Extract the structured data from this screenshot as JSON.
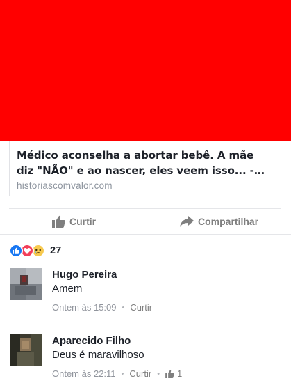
{
  "colors": {
    "hero": "#ff0000",
    "link_title": "#1d2129",
    "muted": "#8d949e",
    "action": "#7f7f7f",
    "like_blue": "#1877f2",
    "love_red": "#f33e58",
    "sad_yellow": "#f7c94e"
  },
  "link_preview": {
    "title": "Médico aconselha a abortar bebê. A mãe diz \"NÃO\" e ao nascer, eles veem isso... - Histórias com Valor",
    "domain": "historiascomvalor.com"
  },
  "actions": {
    "like_label": "Curtir",
    "like_icon": "thumbs-up-icon",
    "share_label": "Compartilhar",
    "share_icon": "share-arrow-icon"
  },
  "reactions": {
    "icons": [
      "like-reaction-icon",
      "love-reaction-icon",
      "sad-reaction-icon"
    ],
    "count": "27"
  },
  "comments": [
    {
      "author": "Hugo Pereira",
      "text": "Amem",
      "time": "Ontem às 15:09",
      "like_label": "Curtir",
      "likes": ""
    },
    {
      "author": "Aparecido Filho",
      "text": "Deus é maravilhoso",
      "time": "Ontem às 22:11",
      "like_label": "Curtir",
      "likes": "1"
    }
  ],
  "separator": "•"
}
